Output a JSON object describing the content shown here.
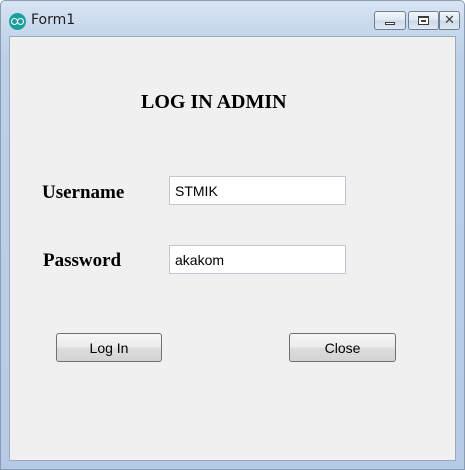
{
  "window": {
    "title": "Form1",
    "icon": "app-icon",
    "controls": {
      "minimize_icon": "minimize-icon",
      "maximize_icon": "maximize-icon",
      "close_glyph": "✕"
    }
  },
  "form": {
    "heading": "LOG IN ADMIN",
    "username_label": "Username",
    "username_value": "STMIK",
    "password_label": "Password",
    "password_value": "akakom",
    "login_button": "Log In",
    "close_button": "Close"
  }
}
